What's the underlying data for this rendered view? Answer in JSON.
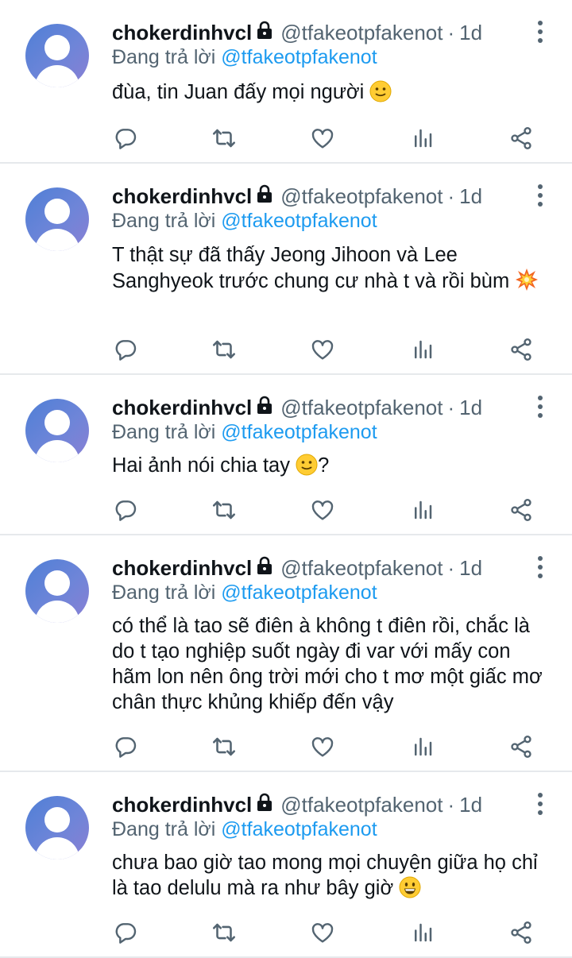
{
  "colors": {
    "accent": "#1d9bf0",
    "secondary_text": "#536471",
    "primary_text": "#0f1419",
    "divider": "#e6e9ec"
  },
  "tweets": [
    {
      "display_name": "chokerdinhvcl",
      "handle": "@tfakeotpfakenot",
      "separator": "·",
      "time": "1d",
      "reply_prefix": "Đang trả lời",
      "reply_to": "@tfakeotpfakenot",
      "text": "đùa, tin Juan đấy mọi người",
      "text_after_emoji": "",
      "emoji": "slightly-smiling-face"
    },
    {
      "display_name": "chokerdinhvcl",
      "handle": "@tfakeotpfakenot",
      "separator": "·",
      "time": "1d",
      "reply_prefix": "Đang trả lời",
      "reply_to": "@tfakeotpfakenot",
      "text": "T thật sự đã thấy Jeong Jihoon và Lee Sanghyeok trước chung cư nhà t và rồi bùm",
      "text_after_emoji": "",
      "emoji": "collision"
    },
    {
      "display_name": "chokerdinhvcl",
      "handle": "@tfakeotpfakenot",
      "separator": "·",
      "time": "1d",
      "reply_prefix": "Đang trả lời",
      "reply_to": "@tfakeotpfakenot",
      "text": "Hai ảnh nói chia tay",
      "text_after_emoji": "?",
      "emoji": "slightly-smiling-face"
    },
    {
      "display_name": "chokerdinhvcl",
      "handle": "@tfakeotpfakenot",
      "separator": "·",
      "time": "1d",
      "reply_prefix": "Đang trả lời",
      "reply_to": "@tfakeotpfakenot",
      "text": "có thể là tao sẽ điên à không t điên rồi, chắc là do t tạo nghiệp suốt ngày đi var với mấy con hãm lon nên ông trời mới cho t mơ một giấc mơ chân thực khủng khiếp đến vậy",
      "text_after_emoji": "",
      "emoji": ""
    },
    {
      "display_name": "chokerdinhvcl",
      "handle": "@tfakeotpfakenot",
      "separator": "·",
      "time": "1d",
      "reply_prefix": "Đang trả lời",
      "reply_to": "@tfakeotpfakenot",
      "text": "chưa bao giờ tao mong mọi chuyện giữa họ chỉ là tao delulu mà ra như bây giờ",
      "text_after_emoji": "",
      "emoji": "grinning-face"
    }
  ]
}
